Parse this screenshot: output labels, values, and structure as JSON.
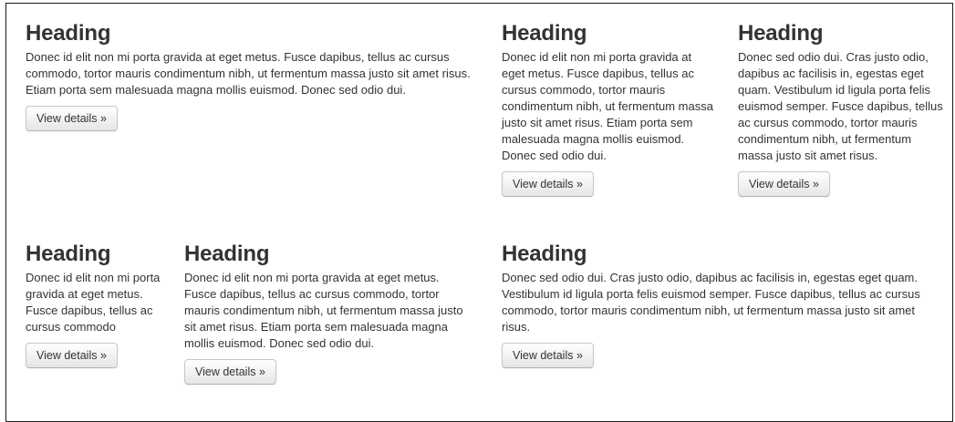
{
  "cards": [
    {
      "heading": "Heading",
      "text": "Donec id elit non mi porta gravida at eget metus. Fusce dapibus, tellus ac cursus commodo, tortor mauris condimentum nibh, ut fermentum massa justo sit amet risus. Etiam porta sem malesuada magna mollis euismod. Donec sed odio dui.",
      "button": "View details »"
    },
    {
      "heading": "Heading",
      "text": "Donec id elit non mi porta gravida at eget metus. Fusce dapibus, tellus ac cursus commodo, tortor mauris condimentum nibh, ut fermentum massa justo sit amet risus. Etiam porta sem malesuada magna mollis euismod. Donec sed odio dui.",
      "button": "View details »"
    },
    {
      "heading": "Heading",
      "text": "Donec sed odio dui. Cras justo odio, dapibus ac facilisis in, egestas eget quam. Vestibulum id ligula porta felis euismod semper. Fusce dapibus, tellus ac cursus commodo, tortor mauris condimentum nibh, ut fermentum massa justo sit amet risus.",
      "button": "View details »"
    },
    {
      "heading": "Heading",
      "text": "Donec id elit non mi porta gravida at eget metus. Fusce dapibus, tellus ac cursus commodo",
      "button": "View details »"
    },
    {
      "heading": "Heading",
      "text": "Donec id elit non mi porta gravida at eget metus. Fusce dapibus, tellus ac cursus commodo, tortor mauris condimentum nibh, ut fermentum massa justo sit amet risus. Etiam porta sem malesuada magna mollis euismod. Donec sed odio dui.",
      "button": "View details »"
    },
    {
      "heading": "Heading",
      "text": "Donec sed odio dui. Cras justo odio, dapibus ac facilisis in, egestas eget quam. Vestibulum id ligula porta felis euismod semper. Fusce dapibus, tellus ac cursus commodo, tortor mauris condimentum nibh, ut fermentum massa justo sit amet risus.",
      "button": "View details »"
    }
  ]
}
